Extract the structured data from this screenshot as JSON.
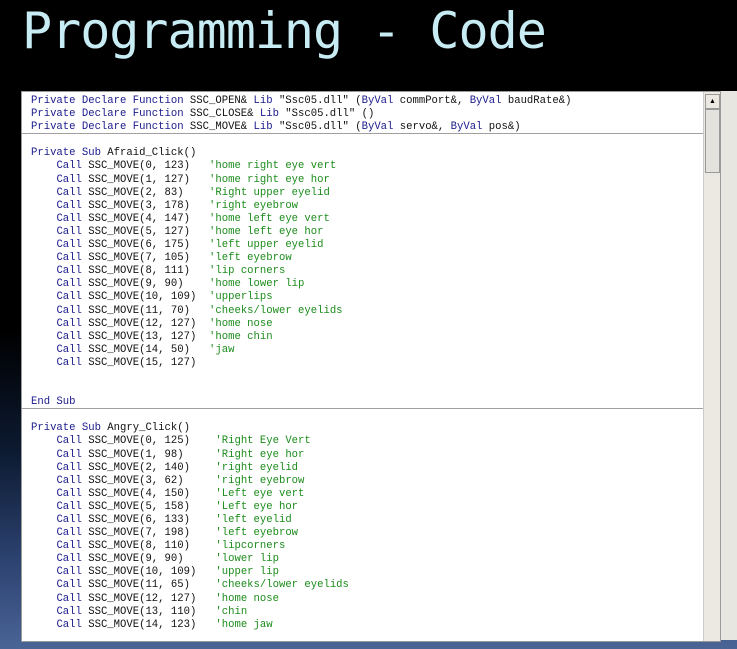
{
  "slide": {
    "title": "Programming - Code"
  },
  "colors": {
    "keyword": "#1a1a8c",
    "comment": "#1c8c1c",
    "text": "#111111",
    "title": "#c8ecf4"
  },
  "editor": {
    "lines": [
      {
        "t": [
          [
            "k",
            "Private Declare Function"
          ],
          [
            "t",
            " SSC_OPEN& "
          ],
          [
            "k",
            "Lib"
          ],
          [
            "t",
            " \"Ssc05.dll\" ("
          ],
          [
            "k",
            "ByVal"
          ],
          [
            "t",
            " commPort&, "
          ],
          [
            "k",
            "ByVal"
          ],
          [
            "t",
            " baudRate&)"
          ]
        ]
      },
      {
        "t": [
          [
            "k",
            "Private Declare Function"
          ],
          [
            "t",
            " SSC_CLOSE& "
          ],
          [
            "k",
            "Lib"
          ],
          [
            "t",
            " \"Ssc05.dll\" ()"
          ]
        ]
      },
      {
        "div": true,
        "t": [
          [
            "k",
            "Private Declare Function"
          ],
          [
            "t",
            " SSC_MOVE& "
          ],
          [
            "k",
            "Lib"
          ],
          [
            "t",
            " \"Ssc05.dll\" ("
          ],
          [
            "k",
            "ByVal"
          ],
          [
            "t",
            " servo&, "
          ],
          [
            "k",
            "ByVal"
          ],
          [
            "t",
            " pos&)"
          ]
        ]
      },
      {
        "t": []
      },
      {
        "t": [
          [
            "k",
            "Private Sub"
          ],
          [
            "t",
            " Afraid_Click()"
          ]
        ]
      },
      {
        "t": [
          [
            "t",
            "    "
          ],
          [
            "k",
            "Call"
          ],
          [
            "t",
            " SSC_MOVE(0, 123)   "
          ],
          [
            "c",
            "'home right eye vert"
          ]
        ]
      },
      {
        "t": [
          [
            "t",
            "    "
          ],
          [
            "k",
            "Call"
          ],
          [
            "t",
            " SSC_MOVE(1, 127)   "
          ],
          [
            "c",
            "'home right eye hor"
          ]
        ]
      },
      {
        "t": [
          [
            "t",
            "    "
          ],
          [
            "k",
            "Call"
          ],
          [
            "t",
            " SSC_MOVE(2, 83)    "
          ],
          [
            "c",
            "'Right upper eyelid"
          ]
        ]
      },
      {
        "t": [
          [
            "t",
            "    "
          ],
          [
            "k",
            "Call"
          ],
          [
            "t",
            " SSC_MOVE(3, 178)   "
          ],
          [
            "c",
            "'right eyebrow"
          ]
        ]
      },
      {
        "t": [
          [
            "t",
            "    "
          ],
          [
            "k",
            "Call"
          ],
          [
            "t",
            " SSC_MOVE(4, 147)   "
          ],
          [
            "c",
            "'home left eye vert"
          ]
        ]
      },
      {
        "t": [
          [
            "t",
            "    "
          ],
          [
            "k",
            "Call"
          ],
          [
            "t",
            " SSC_MOVE(5, 127)   "
          ],
          [
            "c",
            "'home left eye hor"
          ]
        ]
      },
      {
        "t": [
          [
            "t",
            "    "
          ],
          [
            "k",
            "Call"
          ],
          [
            "t",
            " SSC_MOVE(6, 175)   "
          ],
          [
            "c",
            "'left upper eyelid"
          ]
        ]
      },
      {
        "t": [
          [
            "t",
            "    "
          ],
          [
            "k",
            "Call"
          ],
          [
            "t",
            " SSC_MOVE(7, 105)   "
          ],
          [
            "c",
            "'left eyebrow"
          ]
        ]
      },
      {
        "t": [
          [
            "t",
            "    "
          ],
          [
            "k",
            "Call"
          ],
          [
            "t",
            " SSC_MOVE(8, 111)   "
          ],
          [
            "c",
            "'lip corners"
          ]
        ]
      },
      {
        "t": [
          [
            "t",
            "    "
          ],
          [
            "k",
            "Call"
          ],
          [
            "t",
            " SSC_MOVE(9, 90)    "
          ],
          [
            "c",
            "'home lower lip"
          ]
        ]
      },
      {
        "t": [
          [
            "t",
            "    "
          ],
          [
            "k",
            "Call"
          ],
          [
            "t",
            " SSC_MOVE(10, 109)  "
          ],
          [
            "c",
            "'upperlips"
          ]
        ]
      },
      {
        "t": [
          [
            "t",
            "    "
          ],
          [
            "k",
            "Call"
          ],
          [
            "t",
            " SSC_MOVE(11, 70)   "
          ],
          [
            "c",
            "'cheeks/lower eyelids"
          ]
        ]
      },
      {
        "t": [
          [
            "t",
            "    "
          ],
          [
            "k",
            "Call"
          ],
          [
            "t",
            " SSC_MOVE(12, 127)  "
          ],
          [
            "c",
            "'home nose"
          ]
        ]
      },
      {
        "t": [
          [
            "t",
            "    "
          ],
          [
            "k",
            "Call"
          ],
          [
            "t",
            " SSC_MOVE(13, 127)  "
          ],
          [
            "c",
            "'home chin"
          ]
        ]
      },
      {
        "t": [
          [
            "t",
            "    "
          ],
          [
            "k",
            "Call"
          ],
          [
            "t",
            " SSC_MOVE(14, 50)   "
          ],
          [
            "c",
            "'jaw"
          ]
        ]
      },
      {
        "t": [
          [
            "t",
            "    "
          ],
          [
            "k",
            "Call"
          ],
          [
            "t",
            " SSC_MOVE(15, 127)"
          ]
        ]
      },
      {
        "t": []
      },
      {
        "t": []
      },
      {
        "div": true,
        "t": [
          [
            "k",
            "End Sub"
          ]
        ]
      },
      {
        "t": []
      },
      {
        "t": [
          [
            "k",
            "Private Sub"
          ],
          [
            "t",
            " Angry_Click()"
          ]
        ]
      },
      {
        "t": [
          [
            "t",
            "    "
          ],
          [
            "k",
            "Call"
          ],
          [
            "t",
            " SSC_MOVE(0, 125)    "
          ],
          [
            "c",
            "'Right Eye Vert"
          ]
        ]
      },
      {
        "t": [
          [
            "t",
            "    "
          ],
          [
            "k",
            "Call"
          ],
          [
            "t",
            " SSC_MOVE(1, 98)     "
          ],
          [
            "c",
            "'Right eye hor"
          ]
        ]
      },
      {
        "t": [
          [
            "t",
            "    "
          ],
          [
            "k",
            "Call"
          ],
          [
            "t",
            " SSC_MOVE(2, 140)    "
          ],
          [
            "c",
            "'right eyelid"
          ]
        ]
      },
      {
        "t": [
          [
            "t",
            "    "
          ],
          [
            "k",
            "Call"
          ],
          [
            "t",
            " SSC_MOVE(3, 62)     "
          ],
          [
            "c",
            "'right eyebrow"
          ]
        ]
      },
      {
        "t": [
          [
            "t",
            "    "
          ],
          [
            "k",
            "Call"
          ],
          [
            "t",
            " SSC_MOVE(4, 150)    "
          ],
          [
            "c",
            "'Left eye vert"
          ]
        ]
      },
      {
        "t": [
          [
            "t",
            "    "
          ],
          [
            "k",
            "Call"
          ],
          [
            "t",
            " SSC_MOVE(5, 158)    "
          ],
          [
            "c",
            "'Left eye hor"
          ]
        ]
      },
      {
        "t": [
          [
            "t",
            "    "
          ],
          [
            "k",
            "Call"
          ],
          [
            "t",
            " SSC_MOVE(6, 133)    "
          ],
          [
            "c",
            "'left eyelid"
          ]
        ]
      },
      {
        "t": [
          [
            "t",
            "    "
          ],
          [
            "k",
            "Call"
          ],
          [
            "t",
            " SSC_MOVE(7, 198)    "
          ],
          [
            "c",
            "'left eyebrow"
          ]
        ]
      },
      {
        "t": [
          [
            "t",
            "    "
          ],
          [
            "k",
            "Call"
          ],
          [
            "t",
            " SSC_MOVE(8, 110)    "
          ],
          [
            "c",
            "'lipcorners"
          ]
        ]
      },
      {
        "t": [
          [
            "t",
            "    "
          ],
          [
            "k",
            "Call"
          ],
          [
            "t",
            " SSC_MOVE(9, 90)     "
          ],
          [
            "c",
            "'lower lip"
          ]
        ]
      },
      {
        "t": [
          [
            "t",
            "    "
          ],
          [
            "k",
            "Call"
          ],
          [
            "t",
            " SSC_MOVE(10, 109)   "
          ],
          [
            "c",
            "'upper lip"
          ]
        ]
      },
      {
        "t": [
          [
            "t",
            "    "
          ],
          [
            "k",
            "Call"
          ],
          [
            "t",
            " SSC_MOVE(11, 65)    "
          ],
          [
            "c",
            "'cheeks/lower eyelids"
          ]
        ]
      },
      {
        "t": [
          [
            "t",
            "    "
          ],
          [
            "k",
            "Call"
          ],
          [
            "t",
            " SSC_MOVE(12, 127)   "
          ],
          [
            "c",
            "'home nose"
          ]
        ]
      },
      {
        "t": [
          [
            "t",
            "    "
          ],
          [
            "k",
            "Call"
          ],
          [
            "t",
            " SSC_MOVE(13, 110)   "
          ],
          [
            "c",
            "'chin"
          ]
        ]
      },
      {
        "t": [
          [
            "t",
            "    "
          ],
          [
            "k",
            "Call"
          ],
          [
            "t",
            " SSC_MOVE(14, 123)   "
          ],
          [
            "c",
            "'home jaw"
          ]
        ]
      }
    ]
  },
  "scrollbar": {
    "up_icon": "▲"
  }
}
